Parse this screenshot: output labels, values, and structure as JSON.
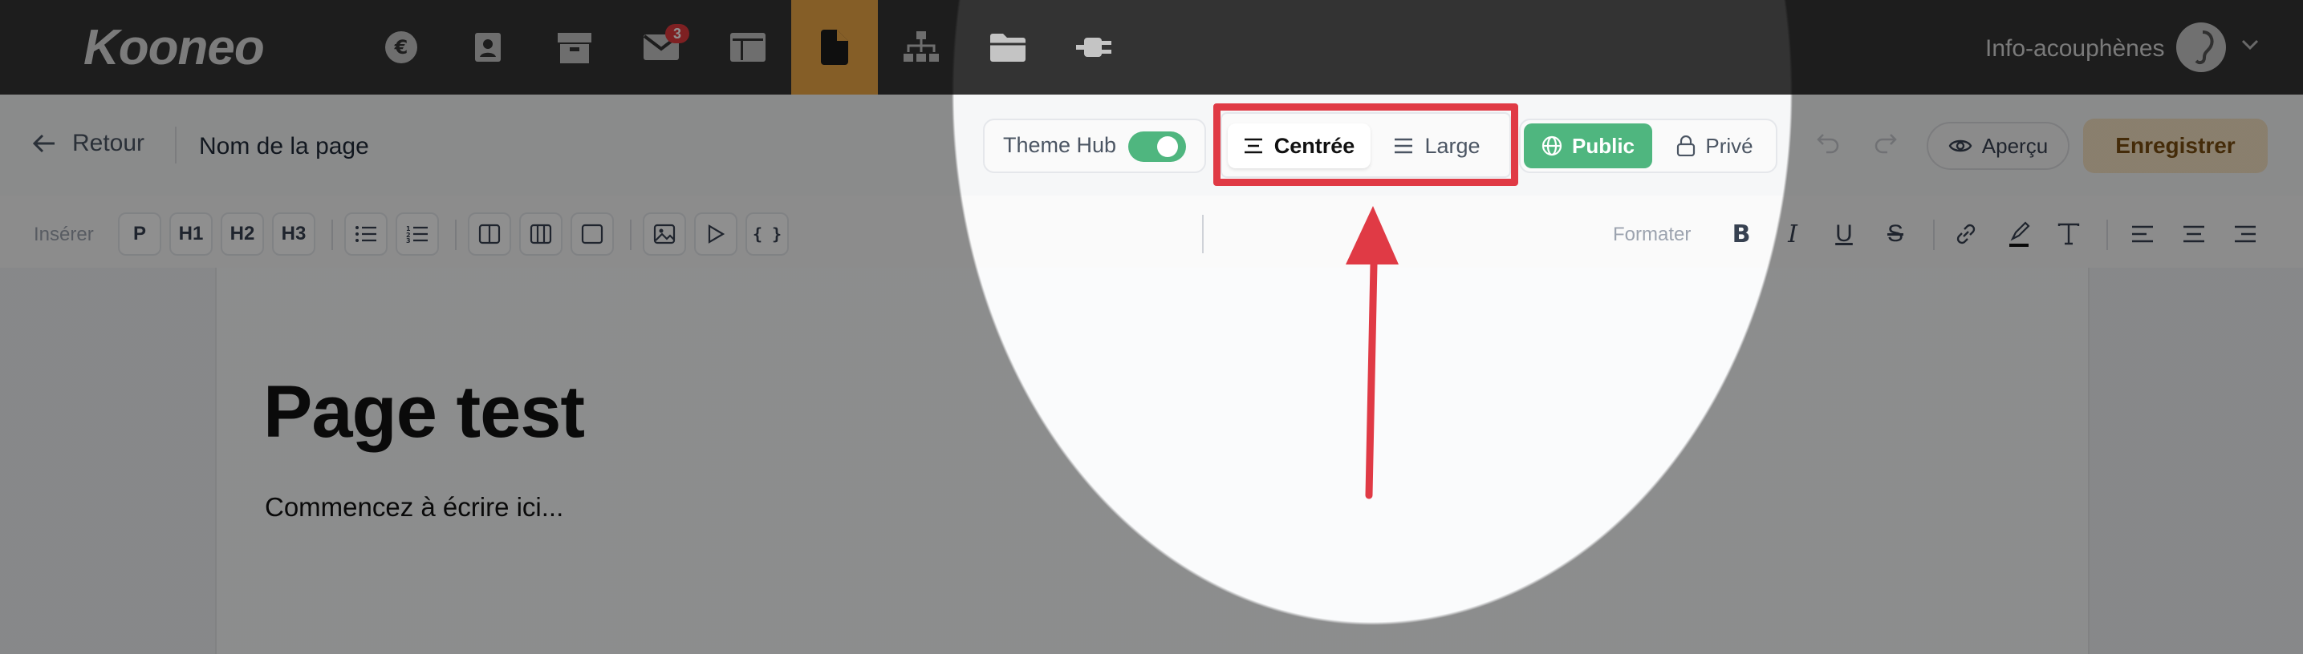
{
  "topbar": {
    "logo": "Kooneo",
    "nav_icons": [
      "euro-icon",
      "contacts-icon",
      "products-icon",
      "mail-icon",
      "table-icon",
      "page-icon",
      "sitemap-icon",
      "folder-icon",
      "plugin-icon"
    ],
    "mail_badge": "3",
    "active_icon": "page-icon",
    "account_name": "Info-acouphènes"
  },
  "header": {
    "back_label": "Retour",
    "page_name": "Nom de la page",
    "theme_hub_label": "Theme Hub",
    "theme_hub_enabled": true,
    "layout_options": {
      "centered": "Centrée",
      "wide": "Large"
    },
    "layout_selected": "Centrée",
    "visibility_options": {
      "public": "Public",
      "private": "Privé"
    },
    "visibility_selected": "Public",
    "preview_label": "Aperçu",
    "save_label": "Enregistrer"
  },
  "toolbar": {
    "insert_label": "Insérer",
    "blocks": [
      "P",
      "H1",
      "H2",
      "H3"
    ],
    "code_label": "{ }",
    "format_label": "Formater"
  },
  "content": {
    "heading": "Page test",
    "placeholder": "Commencez à écrire ici..."
  },
  "colors": {
    "accent_green": "#4fb67f",
    "active_nav": "#eda845",
    "highlight_red": "#e03a45",
    "save_bg": "#f5e2c3"
  }
}
